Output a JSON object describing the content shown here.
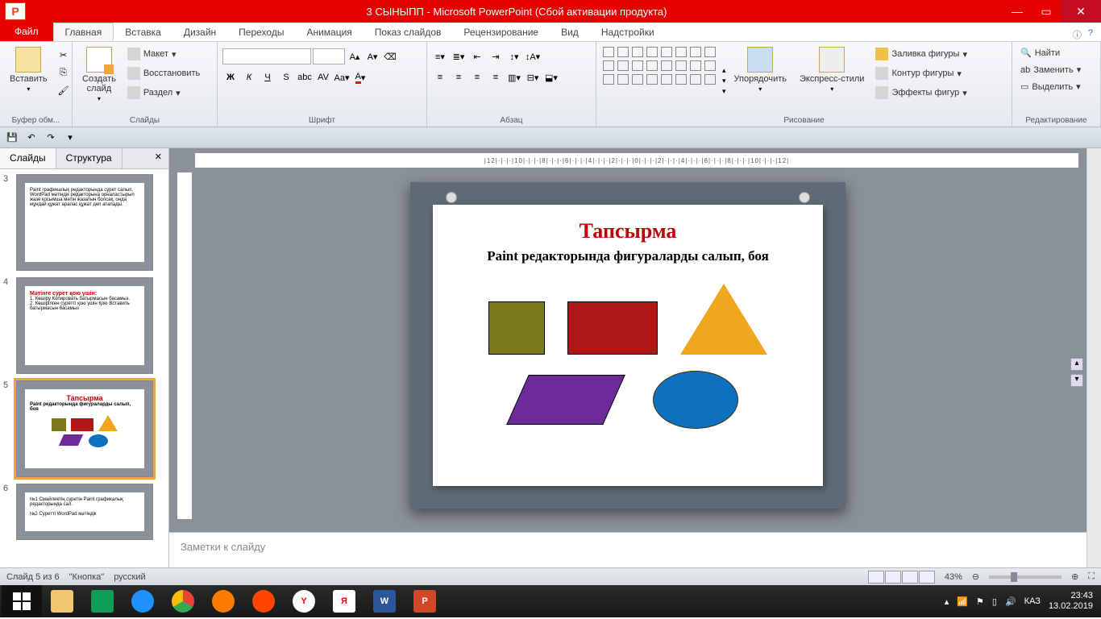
{
  "titlebar": {
    "app_icon": "P",
    "title": "3 СЫНЫПП - Microsoft PowerPoint (Сбой активации продукта)"
  },
  "tabs": {
    "file": "Файл",
    "items": [
      "Главная",
      "Вставка",
      "Дизайн",
      "Переходы",
      "Анимация",
      "Показ слайдов",
      "Рецензирование",
      "Вид",
      "Надстройки"
    ],
    "active": 0
  },
  "ribbon": {
    "clipboard": {
      "label": "Буфер обм...",
      "paste": "Вставить"
    },
    "slides": {
      "label": "Слайды",
      "new": "Создать\nслайд",
      "layout": "Макет",
      "reset": "Восстановить",
      "section": "Раздел"
    },
    "font": {
      "label": "Шрифт"
    },
    "paragraph": {
      "label": "Абзац"
    },
    "drawing": {
      "label": "Рисование",
      "arrange": "Упорядочить",
      "quick": "Экспресс-стили",
      "fill": "Заливка фигуры",
      "outline": "Контур фигуры",
      "effects": "Эффекты фигур"
    },
    "editing": {
      "label": "Редактирование",
      "find": "Найти",
      "replace": "Заменить",
      "select": "Выделить"
    }
  },
  "leftpanel": {
    "tab1": "Слайды",
    "tab2": "Структура"
  },
  "thumbs": [
    {
      "num": "3",
      "text": "Paint графикалық редакторында сурет салып, WordPad мәтіндік редакторына орналастырып жазе қосымша мәтін жазатын болсақ, онда мұндай құжат аралас құжат деп аталады."
    },
    {
      "num": "4",
      "head": "Мәтінге сурет қою үшін:",
      "text": "1. Көшіру Копировать батырмасын басамыз.\n2. Көшірілген суретті қою үшін Қою Вставить батырмасын басамыз"
    },
    {
      "num": "5",
      "title": "Тапсырма",
      "sub": "Paint редакторында фигураларды салып, боя"
    },
    {
      "num": "6",
      "text": "№1 Смайликтің суретін Paint графикалық редакторында сал.\n\n№2 Суретті WordPad мәтіндік"
    }
  ],
  "slide": {
    "title": "Тапсырма",
    "sub": "Paint редакторында фигураларды салып, боя"
  },
  "notes": {
    "placeholder": "Заметки к слайду"
  },
  "status": {
    "slide": "Слайд 5 из 6",
    "theme": "\"Кнопка\"",
    "lang": "русский",
    "zoom": "43%"
  },
  "taskbar": {
    "lang": "КАЗ",
    "time": "23:43",
    "date": "13.02.2019"
  }
}
